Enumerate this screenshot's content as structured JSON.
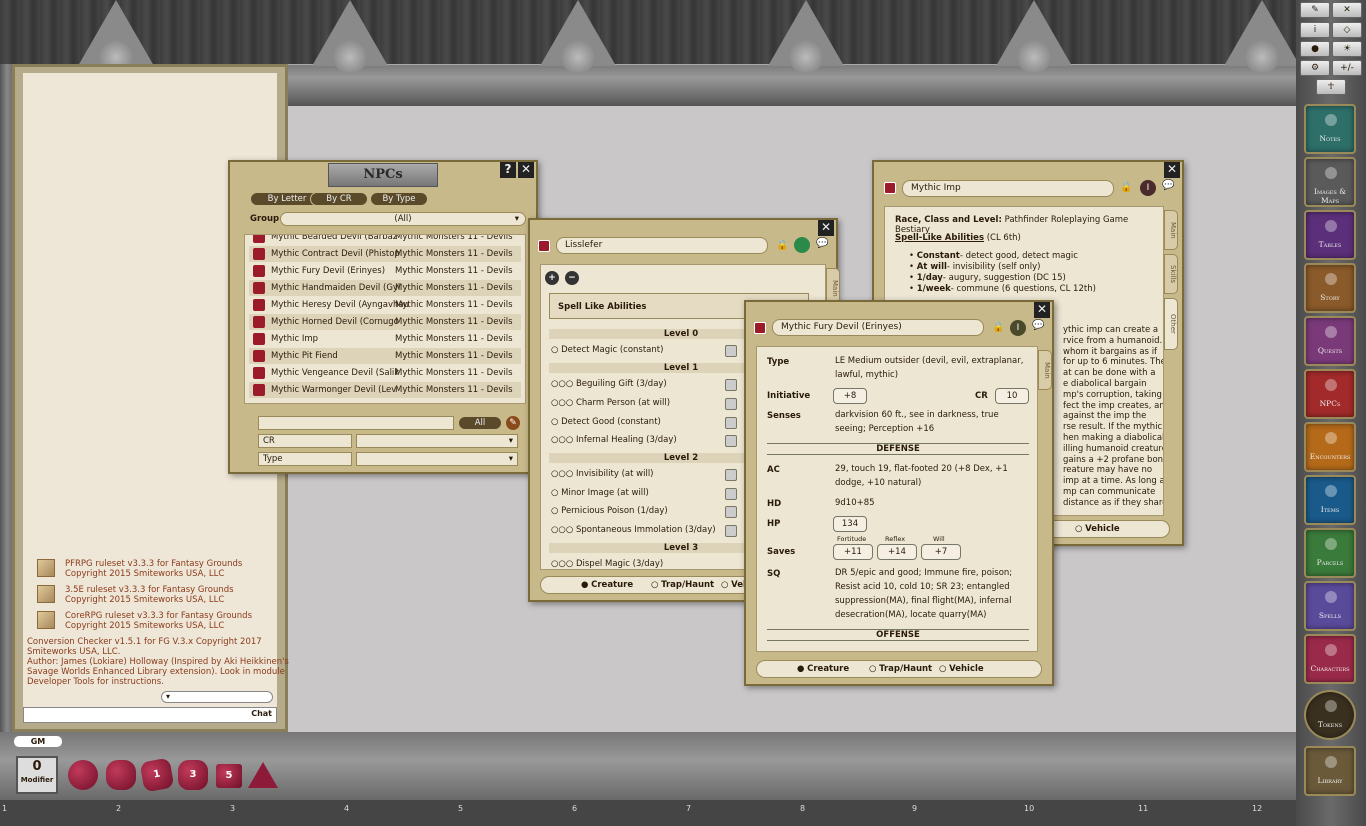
{
  "sidebar": {
    "tools": [
      "✕",
      "i",
      "⚙",
      "+/-"
    ],
    "buttons": [
      {
        "label": "Notes",
        "color": "#2e6f6a"
      },
      {
        "label": "Images & Maps",
        "color": "#5a5a5a"
      },
      {
        "label": "Tables",
        "color": "#5b2f7a"
      },
      {
        "label": "Story",
        "color": "#8a5a2a"
      },
      {
        "label": "Quests",
        "color": "#7a3a7a"
      },
      {
        "label": "NPCs",
        "color": "#a22a2a"
      },
      {
        "label": "Encounters",
        "color": "#b56a1a"
      },
      {
        "label": "Items",
        "color": "#1a5a8a"
      },
      {
        "label": "Parcels",
        "color": "#3a7a3a"
      },
      {
        "label": "Spells",
        "color": "#5a4a9a"
      },
      {
        "label": "Characters",
        "color": "#9a2a4a"
      },
      {
        "label": "Tokens",
        "color": "#3a3020"
      },
      {
        "label": "Library",
        "color": "#6a5a3a"
      }
    ]
  },
  "chat": {
    "messages": [
      {
        "text": "PFRPG ruleset v3.3.3 for Fantasy Grounds\nCopyright 2015 Smiteworks USA, LLC",
        "icon": true
      },
      {
        "text": "3.5E ruleset v3.3.3 for Fantasy Grounds\nCopyright 2015 Smiteworks USA, LLC",
        "icon": true
      },
      {
        "text": "CoreRPG ruleset v3.3.3 for Fantasy Grounds\nCopyright 2015 Smiteworks USA, LLC",
        "icon": true
      },
      {
        "text": "Conversion Checker v1.5.1 for FG V.3.x Copyright 2017\nSmiteworks USA, LLC.\nAuthor: James (Lokiare) Holloway (Inspired by Aki Heikkinen's\nSavage Worlds Enhanced Library extension). Look in module\nDeveloper Tools for instructions.",
        "icon": false
      }
    ],
    "chat_button": "Chat"
  },
  "bottom": {
    "gm": "GM",
    "modifier_value": "0",
    "modifier_label": "Modifier",
    "dice": [
      "d20",
      "d12",
      "d10",
      "d8",
      "d6",
      "d4"
    ],
    "dice_labels": [
      "",
      "",
      "1",
      "3",
      "5",
      ""
    ],
    "ruler": [
      "1",
      "2",
      "3",
      "4",
      "5",
      "6",
      "7",
      "8",
      "9",
      "10",
      "11",
      "12"
    ]
  },
  "npcs": {
    "title": "NPCs",
    "filters": [
      "By Letter",
      "By CR",
      "By Type"
    ],
    "group_label": "Group",
    "group_value": "(All)",
    "rows": [
      {
        "name": "Mythic Bearded Devil (Barbaz",
        "src": "Mythic Monsters 11 - Devils"
      },
      {
        "name": "Mythic Contract Devil (Phistop",
        "src": "Mythic Monsters 11 - Devils"
      },
      {
        "name": "Mythic Fury Devil (Erinyes)",
        "src": "Mythic Monsters 11 - Devils"
      },
      {
        "name": "Mythic Handmaiden Devil (Gyl",
        "src": "Mythic Monsters 11 - Devils"
      },
      {
        "name": "Mythic Heresy Devil (Ayngavhau",
        "src": "Mythic Monsters 11 - Devils"
      },
      {
        "name": "Mythic Horned Devil (Cornugo",
        "src": "Mythic Monsters 11 - Devils"
      },
      {
        "name": "Mythic Imp",
        "src": "Mythic Monsters 11 - Devils"
      },
      {
        "name": "Mythic Pit Fiend",
        "src": "Mythic Monsters 11 - Devils"
      },
      {
        "name": "Mythic Vengeance Devil (Salik",
        "src": "Mythic Monsters 11 - Devils"
      },
      {
        "name": "Mythic Warmonger Devil (Lev",
        "src": "Mythic Monsters 11 - Devils"
      }
    ],
    "all_button": "All",
    "cr_label": "CR",
    "type_label": "Type"
  },
  "lisslefer": {
    "name": "Lisslefer",
    "section": "Spell Like Abilities",
    "tabs": [
      "Main"
    ],
    "spells": [
      {
        "level": "Level 0",
        "items": [
          {
            "dots": "○",
            "name": "Detect Magic (constant)"
          }
        ]
      },
      {
        "level": "Level 1",
        "items": [
          {
            "dots": "○○○",
            "name": "Beguiling Gift (3/day)"
          },
          {
            "dots": "○○○",
            "name": "Charm Person (at will)"
          },
          {
            "dots": "○",
            "name": "Detect Good (constant)"
          },
          {
            "dots": "○○○",
            "name": "Infernal Healing (3/day)"
          }
        ]
      },
      {
        "level": "Level 2",
        "items": [
          {
            "dots": "○○○",
            "name": "Invisibility (at will)"
          },
          {
            "dots": "○",
            "name": "Minor Image (at will)"
          },
          {
            "dots": "○",
            "name": "Pernicious Poison (1/day)"
          },
          {
            "dots": "○○○",
            "name": "Spontaneous Immolation (3/day)"
          }
        ]
      },
      {
        "level": "Level 3",
        "items": [
          {
            "dots": "○○○",
            "name": "Dispel Magic (3/day)"
          }
        ]
      }
    ],
    "footer": [
      "Creature",
      "Trap/Haunt",
      "Vehi"
    ]
  },
  "imp": {
    "name": "Mythic Imp",
    "race_label": "Race, Class and Level:",
    "race_value": "Pathfinder Roleplaying Game Bestiary",
    "sla_label": "Spell-Like Abilities",
    "sla_cl": "(CL 6th)",
    "bullets": [
      {
        "b": "Constant",
        "t": "- detect good, detect magic"
      },
      {
        "b": "At will",
        "t": "- invisibility (self only)"
      },
      {
        "b": "1/day",
        "t": "- augury, suggestion (DC 15)"
      },
      {
        "b": "1/week",
        "t": "- commune (6 questions, CL 12th)"
      }
    ],
    "text_lines": [
      "ythic imp can create a",
      "rvice from a humanoid. It",
      "whom it bargains as if",
      "for up to 6 minutes. The",
      "at can be done with a",
      "e diabolical bargain",
      "mp's corruption, taking a",
      "fect the imp creates, and",
      "against the imp the",
      "rse result. If the mythic",
      "hen making a diabolical",
      "illing humanoid creature",
      "gains a +2 profane bonus",
      "reature may have no",
      "imp at a time. As long as",
      "mp can communicate",
      "distance as if they shared"
    ],
    "tabs": [
      "Main",
      "Skills",
      "Other"
    ],
    "footer": "Vehicle"
  },
  "fury": {
    "name": "Mythic Fury Devil (Erinyes)",
    "type_label": "Type",
    "type_value": "LE Medium outsider (devil, evil, extraplanar, lawful, mythic)",
    "init_label": "Initiative",
    "init_value": "+8",
    "cr_label": "CR",
    "cr_value": "10",
    "senses_label": "Senses",
    "senses_value": "darkvision 60 ft., see in darkness, true seeing; Perception +16",
    "defense": "DEFENSE",
    "ac_label": "AC",
    "ac_value": "29, touch 19, flat-footed 20 (+8 Dex, +1 dodge, +10 natural)",
    "hd_label": "HD",
    "hd_value": "9d10+85",
    "hp_label": "HP",
    "hp_value": "134",
    "saves_label": "Saves",
    "fort_label": "Fortitude",
    "fort": "+11",
    "ref_label": "Reflex",
    "ref": "+14",
    "will_label": "Will",
    "will": "+7",
    "sq_label": "SQ",
    "sq_value": "DR 5/epic and good; Immune fire, poison; Resist acid 10, cold 10; SR 23; entangled suppression(MA), final flight(MA), infernal desecration(MA), locate quarry(MA)",
    "offense": "OFFENSE",
    "tabs": [
      "Main"
    ],
    "footer": [
      "Creature",
      "Trap/Haunt",
      "Vehicle"
    ]
  }
}
